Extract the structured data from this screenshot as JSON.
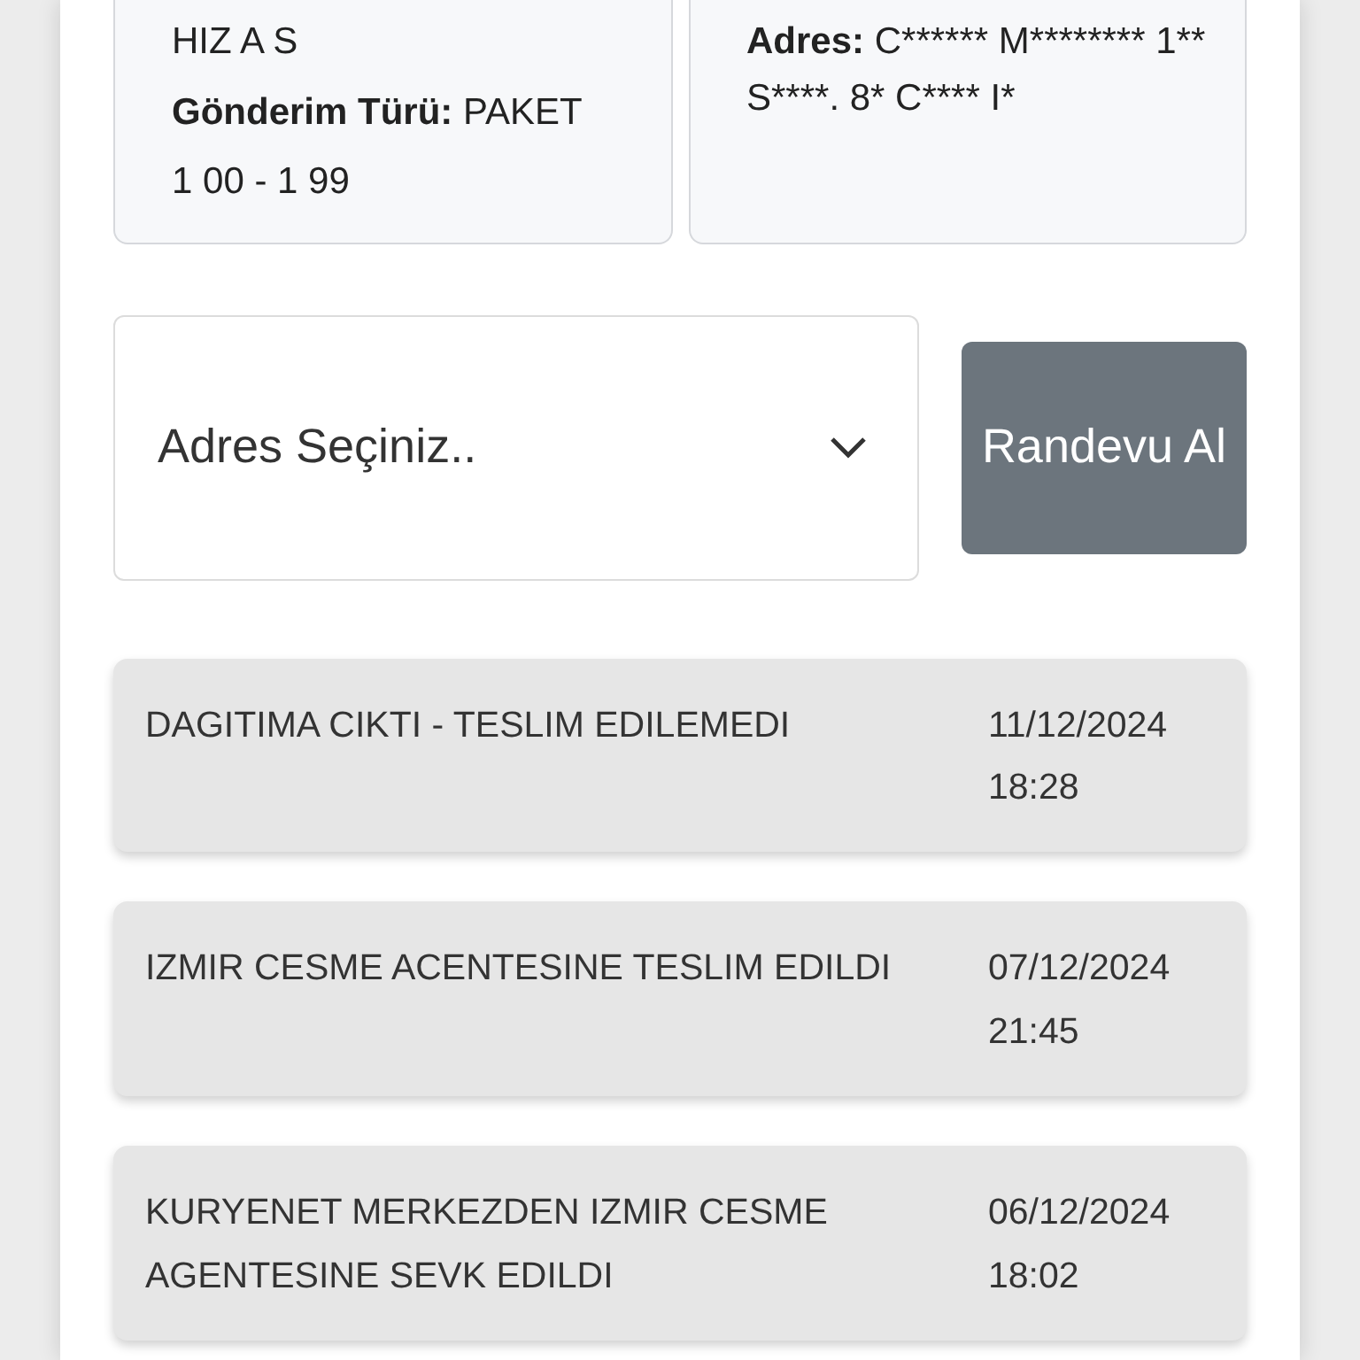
{
  "info_cards": [
    {
      "lines": [
        {
          "value": "HIZ A S"
        },
        {
          "label": "Gönderim Türü:",
          "value": "PAKET"
        },
        {
          "value": "1 00 - 1 99"
        }
      ]
    },
    {
      "lines": [
        {
          "label": "Adres:",
          "value": "C****** M******** 1** S****. 8* C**** I*"
        }
      ]
    }
  ],
  "address_select": {
    "placeholder": "Adres Seçiniz.."
  },
  "appointment_button": "Randevu Al",
  "events": [
    {
      "status": "DAGITIMA CIKTI - TESLIM EDILEMEDI",
      "date": "11/12/2024",
      "time": "18:28"
    },
    {
      "status": "IZMIR CESME ACENTESINE TESLIM EDILDI",
      "date": "07/12/2024",
      "time": "21:45"
    },
    {
      "status": "KURYENET MERKEZDEN IZMIR CESME AGENTESINE SEVK EDILDI",
      "date": "06/12/2024",
      "time": "18:02"
    }
  ]
}
